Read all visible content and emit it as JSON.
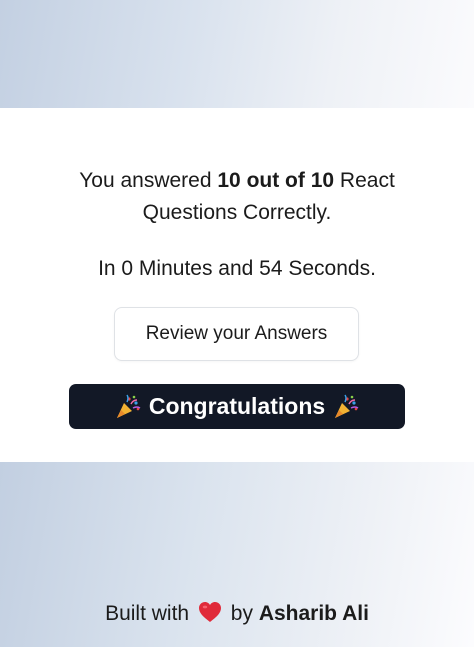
{
  "result": {
    "line1_prefix": "You answered",
    "score": "10 out of 10",
    "line1_suffix": "React",
    "line2": "Questions Correctly.",
    "time_line": "In 0 Minutes and 54 Seconds."
  },
  "actions": {
    "review_label": "Review your Answers",
    "congrats_label": "Congratulations"
  },
  "footer": {
    "prefix": "Built with",
    "middle": "by",
    "author": "Asharib Ali"
  },
  "icons": {
    "party": "party-popper-icon",
    "heart": "heart-icon"
  },
  "colors": {
    "congrats_bg": "#121826",
    "heart": "#e02a3a"
  }
}
